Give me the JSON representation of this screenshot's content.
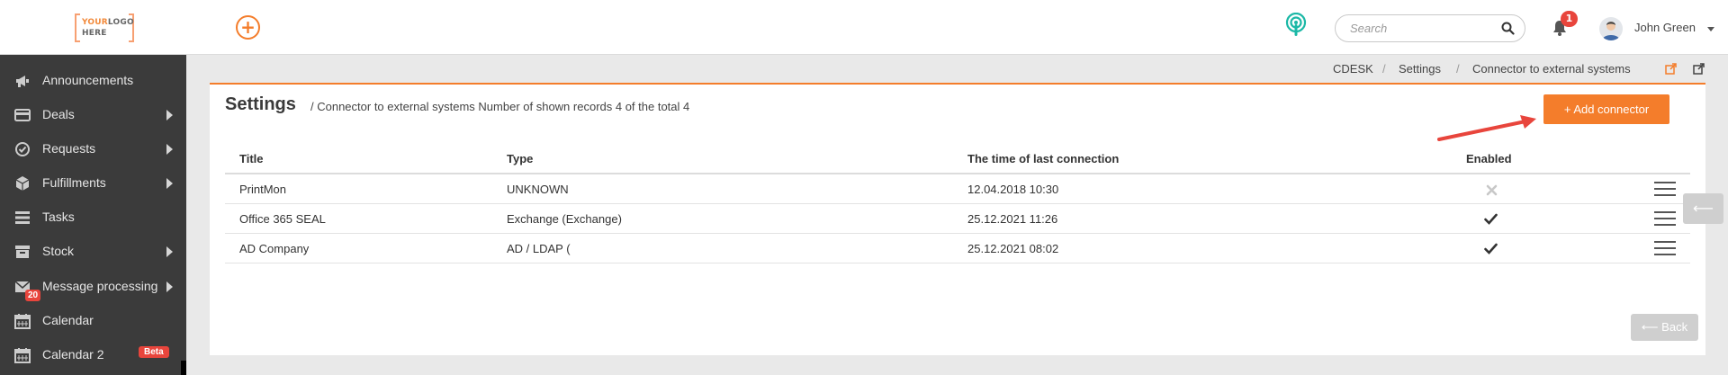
{
  "header": {
    "logo_line1_a": "YOUR",
    "logo_line1_b": "LOGO",
    "logo_line2": "HERE",
    "search_placeholder": "Search",
    "notification_count": "1",
    "user_name": "John Green",
    "accent_color": "#f47d2b"
  },
  "sidebar": {
    "items": [
      {
        "label": "Announcements",
        "icon": "megaphone-icon"
      },
      {
        "label": "Deals",
        "icon": "card-icon"
      },
      {
        "label": "Requests",
        "icon": "check-circle-icon"
      },
      {
        "label": "Fulfillments",
        "icon": "box-icon"
      },
      {
        "label": "Tasks",
        "icon": "list-icon"
      },
      {
        "label": "Stock",
        "icon": "archive-icon"
      },
      {
        "label": "Message processing",
        "icon": "envelope-icon",
        "badge": "20"
      },
      {
        "label": "Calendar",
        "icon": "calendar-icon"
      },
      {
        "label": "Calendar 2",
        "icon": "calendar-icon",
        "badge": "Beta"
      }
    ]
  },
  "breadcrumb": {
    "items": [
      "CDESK",
      "Settings",
      "Connector to external systems"
    ],
    "separator": "/"
  },
  "page": {
    "title": "Settings",
    "subtitle": "/ Connector to external systems Number of shown records 4 of the total 4",
    "add_button": "+ Add connector",
    "back_button": "⟵ Back",
    "side_back": "⟵"
  },
  "table": {
    "headers": [
      "Title",
      "Type",
      "The time of last connection",
      "Enabled"
    ],
    "rows": [
      {
        "title": "PrintMon",
        "type": "UNKNOWN",
        "time": "12.04.2018 10:30",
        "enabled": false
      },
      {
        "title": "Office 365 SEAL",
        "type": "Exchange (Exchange)",
        "time": "25.12.2021 11:26",
        "enabled": true
      },
      {
        "title": "AD Company",
        "type": "AD / LDAP (",
        "time": "25.12.2021 08:02",
        "enabled": true
      }
    ]
  }
}
